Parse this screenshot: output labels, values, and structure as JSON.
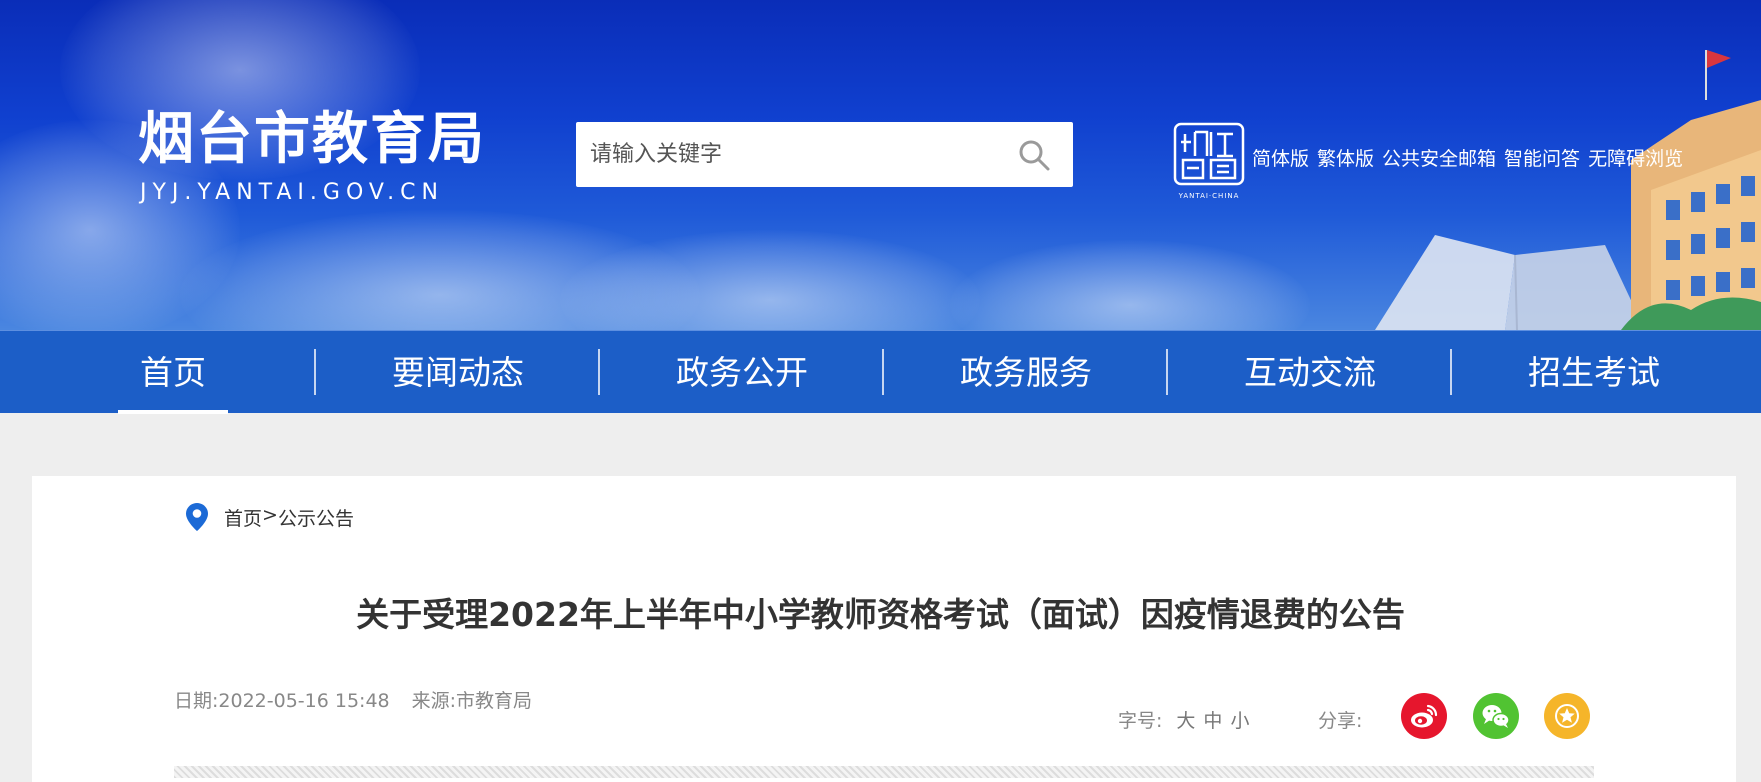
{
  "header": {
    "logo_title": "烟台市教育局",
    "logo_url": "JYJ.YANTAI.GOV.CN",
    "search": {
      "placeholder": "请输入关键字"
    },
    "yantai_logo_caption": "YANTAI·CHINA",
    "top_links": [
      "简体版",
      "繁体版",
      "公共安全邮箱",
      "智能问答",
      "无障碍浏览"
    ]
  },
  "nav": {
    "items": [
      "首页",
      "要闻动态",
      "政务公开",
      "政务服务",
      "互动交流",
      "招生考试"
    ],
    "active_index": 0
  },
  "breadcrumb": {
    "home": "首页",
    "separator": ">",
    "current": "公示公告"
  },
  "article": {
    "title": "关于受理2022年上半年中小学教师资格考试（面试）因疫情退费的公告",
    "date": "日期:2022-05-16 15:48",
    "source": "来源:市教育局"
  },
  "font_size": {
    "label": "字号:",
    "options": [
      "大",
      "中",
      "小"
    ]
  },
  "share": {
    "label": "分享:",
    "weibo_color": "#e6162d",
    "wechat_color": "#51c332",
    "favorite_color": "#f5b52a"
  },
  "colors": {
    "nav_bg": "#1c5ec7",
    "pin_color": "#1c6ad6"
  }
}
